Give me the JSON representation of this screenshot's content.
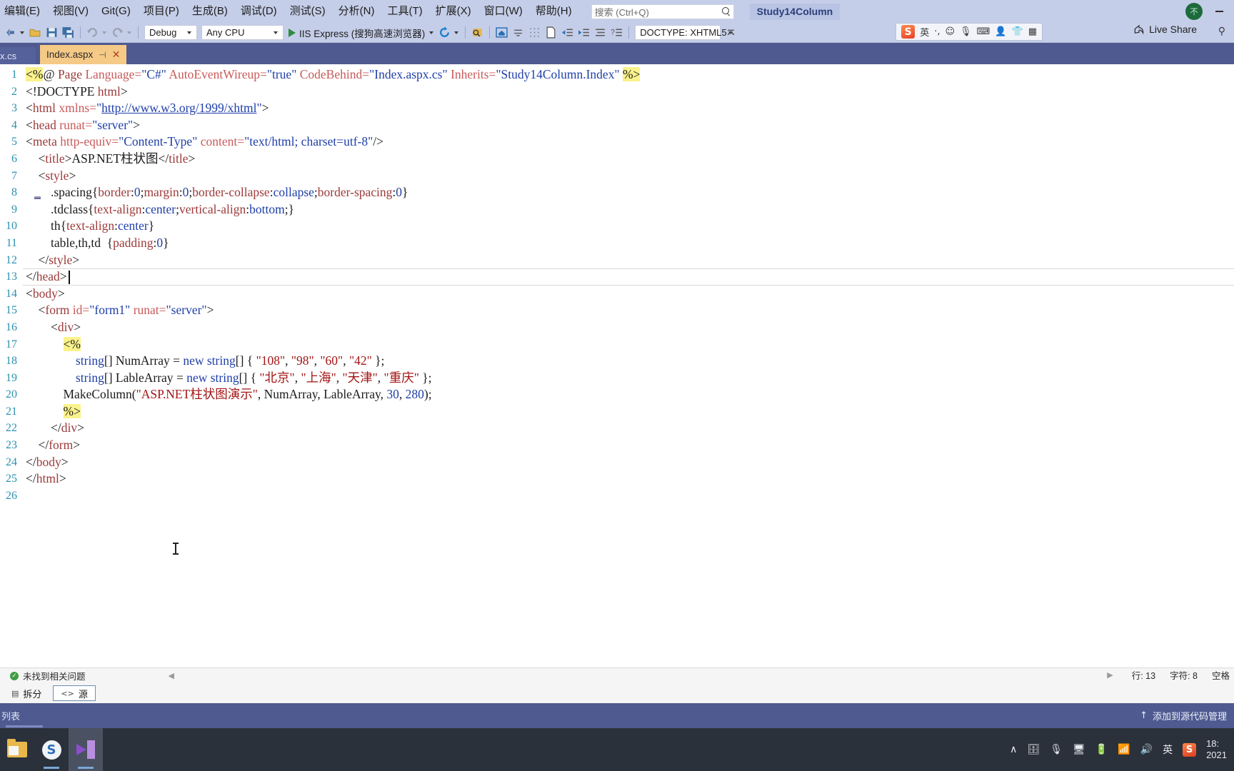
{
  "window": {
    "project_title": "Study14Column",
    "avatar_initials": "不",
    "minimize_label": "—"
  },
  "menubar": {
    "items": [
      {
        "label": "编辑(E)",
        "name": "menu-edit"
      },
      {
        "label": "视图(V)",
        "name": "menu-view"
      },
      {
        "label": "Git(G)",
        "name": "menu-git"
      },
      {
        "label": "项目(P)",
        "name": "menu-project"
      },
      {
        "label": "生成(B)",
        "name": "menu-build"
      },
      {
        "label": "调试(D)",
        "name": "menu-debug"
      },
      {
        "label": "测试(S)",
        "name": "menu-test"
      },
      {
        "label": "分析(N)",
        "name": "menu-analyze"
      },
      {
        "label": "工具(T)",
        "name": "menu-tools"
      },
      {
        "label": "扩展(X)",
        "name": "menu-extensions"
      },
      {
        "label": "窗口(W)",
        "name": "menu-window"
      },
      {
        "label": "帮助(H)",
        "name": "menu-help"
      }
    ],
    "search_placeholder": "搜索 (Ctrl+Q)",
    "search_value": ""
  },
  "toolbar": {
    "config_value": "Debug",
    "platform_value": "Any CPU",
    "run_label": "IIS Express (搜狗高速浏览器)",
    "doctype_value": "DOCTYPE: XHTML5",
    "live_share_label": "Live Share"
  },
  "ime": {
    "brand": "S",
    "mode": "英",
    "icons": [
      "punctuation-icon",
      "emoji-icon",
      "mic-icon",
      "keyboard-icon",
      "user-icon",
      "skin-icon",
      "apps-icon"
    ]
  },
  "tabs": {
    "inactive_label": "x.cs",
    "active_label": "Index.aspx",
    "pin_glyph": "⊣",
    "close_glyph": "✕"
  },
  "editor": {
    "lines": [
      {
        "num": "1",
        "segs": [
          {
            "t": "<%",
            "c": "t-hl"
          },
          {
            "t": "@ ",
            "c": "t-plain"
          },
          {
            "t": "Page ",
            "c": "t-tag"
          },
          {
            "t": "Language=",
            "c": "t-attr"
          },
          {
            "t": "\"C#\"",
            "c": "t-str"
          },
          {
            "t": " ",
            "c": "t-plain"
          },
          {
            "t": "AutoEventWireup=",
            "c": "t-attr"
          },
          {
            "t": "\"true\"",
            "c": "t-str"
          },
          {
            "t": " ",
            "c": "t-plain"
          },
          {
            "t": "CodeBehind=",
            "c": "t-attr"
          },
          {
            "t": "\"Index.aspx.cs\"",
            "c": "t-str"
          },
          {
            "t": " ",
            "c": "t-plain"
          },
          {
            "t": "Inherits=",
            "c": "t-attr"
          },
          {
            "t": "\"Study14Column.Index\"",
            "c": "t-str"
          },
          {
            "t": " ",
            "c": "t-plain"
          },
          {
            "t": "%>",
            "c": "t-hl"
          }
        ]
      },
      {
        "num": "2",
        "segs": [
          {
            "t": "<!DOCTYPE ",
            "c": "t-plain"
          },
          {
            "t": "html",
            "c": "t-tag"
          },
          {
            "t": ">",
            "c": "t-plain"
          }
        ]
      },
      {
        "num": "3",
        "segs": [
          {
            "t": "<",
            "c": "t-plain"
          },
          {
            "t": "html ",
            "c": "t-tag"
          },
          {
            "t": "xmlns=",
            "c": "t-attr"
          },
          {
            "t": "\"",
            "c": "t-str"
          },
          {
            "t": "http://www.w3.org/1999/xhtml",
            "c": "t-link"
          },
          {
            "t": "\"",
            "c": "t-str"
          },
          {
            "t": ">",
            "c": "t-plain"
          }
        ]
      },
      {
        "num": "4",
        "segs": [
          {
            "t": "<",
            "c": "t-plain"
          },
          {
            "t": "head ",
            "c": "t-tag"
          },
          {
            "t": "runat=",
            "c": "t-attr"
          },
          {
            "t": "\"server\"",
            "c": "t-str"
          },
          {
            "t": ">",
            "c": "t-plain"
          }
        ]
      },
      {
        "num": "5",
        "segs": [
          {
            "t": "<",
            "c": "t-plain"
          },
          {
            "t": "meta ",
            "c": "t-tag"
          },
          {
            "t": "http-equiv=",
            "c": "t-attr"
          },
          {
            "t": "\"Content-Type\"",
            "c": "t-str"
          },
          {
            "t": " ",
            "c": "t-plain"
          },
          {
            "t": "content=",
            "c": "t-attr"
          },
          {
            "t": "\"text/html; charset=utf-8\"",
            "c": "t-str"
          },
          {
            "t": "/>",
            "c": "t-plain"
          }
        ]
      },
      {
        "num": "6",
        "segs": [
          {
            "t": "    <",
            "c": "t-plain"
          },
          {
            "t": "title",
            "c": "t-tag"
          },
          {
            "t": ">",
            "c": "t-plain"
          },
          {
            "t": "ASP.NET柱状图",
            "c": "t-plain"
          },
          {
            "t": "</",
            "c": "t-plain"
          },
          {
            "t": "title",
            "c": "t-tag"
          },
          {
            "t": ">",
            "c": "t-plain"
          }
        ]
      },
      {
        "num": "7",
        "segs": [
          {
            "t": "    <",
            "c": "t-plain"
          },
          {
            "t": "style",
            "c": "t-tag"
          },
          {
            "t": ">",
            "c": "t-plain"
          }
        ]
      },
      {
        "num": "8",
        "segs": [
          {
            "t": "        .spacing",
            "c": "t-plain"
          },
          {
            "t": "{",
            "c": "t-plain"
          },
          {
            "t": "border",
            "c": "t-cssprop"
          },
          {
            "t": ":",
            "c": "t-plain"
          },
          {
            "t": "0",
            "c": "t-cssval"
          },
          {
            "t": ";",
            "c": "t-plain"
          },
          {
            "t": "margin",
            "c": "t-cssprop"
          },
          {
            "t": ":",
            "c": "t-plain"
          },
          {
            "t": "0",
            "c": "t-cssval"
          },
          {
            "t": ";",
            "c": "t-plain"
          },
          {
            "t": "border-collapse",
            "c": "t-cssprop"
          },
          {
            "t": ":",
            "c": "t-plain"
          },
          {
            "t": "collapse",
            "c": "t-cssval"
          },
          {
            "t": ";",
            "c": "t-plain"
          },
          {
            "t": "border-spacing",
            "c": "t-cssprop"
          },
          {
            "t": ":",
            "c": "t-plain"
          },
          {
            "t": "0",
            "c": "t-cssval"
          },
          {
            "t": "}",
            "c": "t-plain"
          }
        ]
      },
      {
        "num": "9",
        "segs": [
          {
            "t": "        .tdclass",
            "c": "t-plain"
          },
          {
            "t": "{",
            "c": "t-plain"
          },
          {
            "t": "text-align",
            "c": "t-cssprop"
          },
          {
            "t": ":",
            "c": "t-plain"
          },
          {
            "t": "center",
            "c": "t-cssval"
          },
          {
            "t": ";",
            "c": "t-plain"
          },
          {
            "t": "vertical-align",
            "c": "t-cssprop"
          },
          {
            "t": ":",
            "c": "t-plain"
          },
          {
            "t": "bottom",
            "c": "t-cssval"
          },
          {
            "t": ";}",
            "c": "t-plain"
          }
        ]
      },
      {
        "num": "10",
        "segs": [
          {
            "t": "        th",
            "c": "t-plain"
          },
          {
            "t": "{",
            "c": "t-plain"
          },
          {
            "t": "text-align",
            "c": "t-cssprop"
          },
          {
            "t": ":",
            "c": "t-plain"
          },
          {
            "t": "center",
            "c": "t-cssval"
          },
          {
            "t": "}",
            "c": "t-plain"
          }
        ]
      },
      {
        "num": "11",
        "segs": [
          {
            "t": "        table,th,td  ",
            "c": "t-plain"
          },
          {
            "t": "{",
            "c": "t-plain"
          },
          {
            "t": "padding",
            "c": "t-cssprop"
          },
          {
            "t": ":",
            "c": "t-plain"
          },
          {
            "t": "0",
            "c": "t-cssval"
          },
          {
            "t": "}",
            "c": "t-plain"
          }
        ]
      },
      {
        "num": "12",
        "segs": [
          {
            "t": "    </",
            "c": "t-plain"
          },
          {
            "t": "style",
            "c": "t-tag"
          },
          {
            "t": ">",
            "c": "t-plain"
          }
        ]
      },
      {
        "num": "13",
        "segs": [
          {
            "t": "</",
            "c": "t-plain"
          },
          {
            "t": "head",
            "c": "t-tag"
          },
          {
            "t": ">",
            "c": "t-plain"
          }
        ]
      },
      {
        "num": "14",
        "segs": [
          {
            "t": "<",
            "c": "t-plain"
          },
          {
            "t": "body",
            "c": "t-tag"
          },
          {
            "t": ">",
            "c": "t-plain"
          }
        ]
      },
      {
        "num": "15",
        "segs": [
          {
            "t": "    <",
            "c": "t-plain"
          },
          {
            "t": "form ",
            "c": "t-tag"
          },
          {
            "t": "id=",
            "c": "t-attr"
          },
          {
            "t": "\"form1\"",
            "c": "t-str"
          },
          {
            "t": " ",
            "c": "t-plain"
          },
          {
            "t": "runat=",
            "c": "t-attr"
          },
          {
            "t": "\"server\"",
            "c": "t-str"
          },
          {
            "t": ">",
            "c": "t-plain"
          }
        ]
      },
      {
        "num": "16",
        "segs": [
          {
            "t": "        <",
            "c": "t-plain"
          },
          {
            "t": "div",
            "c": "t-tag"
          },
          {
            "t": ">",
            "c": "t-plain"
          }
        ]
      },
      {
        "num": "17",
        "segs": [
          {
            "t": "            ",
            "c": "t-plain"
          },
          {
            "t": "<%",
            "c": "t-hl"
          }
        ]
      },
      {
        "num": "18",
        "segs": [
          {
            "t": "                ",
            "c": "t-plain"
          },
          {
            "t": "string",
            "c": "t-type"
          },
          {
            "t": "[] ",
            "c": "t-plain"
          },
          {
            "t": "NumArray ",
            "c": "t-id"
          },
          {
            "t": "= ",
            "c": "t-plain"
          },
          {
            "t": "new ",
            "c": "t-type"
          },
          {
            "t": "string",
            "c": "t-type"
          },
          {
            "t": "[] { ",
            "c": "t-plain"
          },
          {
            "t": "\"108\"",
            "c": "t-cstr"
          },
          {
            "t": ", ",
            "c": "t-plain"
          },
          {
            "t": "\"98\"",
            "c": "t-cstr"
          },
          {
            "t": ", ",
            "c": "t-plain"
          },
          {
            "t": "\"60\"",
            "c": "t-cstr"
          },
          {
            "t": ", ",
            "c": "t-plain"
          },
          {
            "t": "\"42\"",
            "c": "t-cstr"
          },
          {
            "t": " };",
            "c": "t-plain"
          }
        ]
      },
      {
        "num": "19",
        "segs": [
          {
            "t": "                ",
            "c": "t-plain"
          },
          {
            "t": "string",
            "c": "t-type"
          },
          {
            "t": "[] ",
            "c": "t-plain"
          },
          {
            "t": "LableArray ",
            "c": "t-id"
          },
          {
            "t": "= ",
            "c": "t-plain"
          },
          {
            "t": "new ",
            "c": "t-type"
          },
          {
            "t": "string",
            "c": "t-type"
          },
          {
            "t": "[] { ",
            "c": "t-plain"
          },
          {
            "t": "\"北京\"",
            "c": "t-cstr"
          },
          {
            "t": ", ",
            "c": "t-plain"
          },
          {
            "t": "\"上海\"",
            "c": "t-cstr"
          },
          {
            "t": ", ",
            "c": "t-plain"
          },
          {
            "t": "\"天津\"",
            "c": "t-cstr"
          },
          {
            "t": ", ",
            "c": "t-plain"
          },
          {
            "t": "\"重庆\"",
            "c": "t-cstr"
          },
          {
            "t": " };",
            "c": "t-plain"
          }
        ]
      },
      {
        "num": "20",
        "segs": [
          {
            "t": "            ",
            "c": "t-plain"
          },
          {
            "t": "MakeColumn",
            "c": "t-id"
          },
          {
            "t": "(",
            "c": "t-plain"
          },
          {
            "t": "\"ASP.NET柱状图演示\"",
            "c": "t-cstr"
          },
          {
            "t": ", ",
            "c": "t-plain"
          },
          {
            "t": "NumArray",
            "c": "t-id"
          },
          {
            "t": ", ",
            "c": "t-plain"
          },
          {
            "t": "LableArray",
            "c": "t-id"
          },
          {
            "t": ", ",
            "c": "t-plain"
          },
          {
            "t": "30",
            "c": "t-num"
          },
          {
            "t": ", ",
            "c": "t-plain"
          },
          {
            "t": "280",
            "c": "t-num"
          },
          {
            "t": ");",
            "c": "t-plain"
          }
        ]
      },
      {
        "num": "21",
        "segs": [
          {
            "t": "            ",
            "c": "t-plain"
          },
          {
            "t": "%>",
            "c": "t-hl"
          }
        ]
      },
      {
        "num": "22",
        "segs": [
          {
            "t": "        </",
            "c": "t-plain"
          },
          {
            "t": "div",
            "c": "t-tag"
          },
          {
            "t": ">",
            "c": "t-plain"
          }
        ]
      },
      {
        "num": "23",
        "segs": [
          {
            "t": "    </",
            "c": "t-plain"
          },
          {
            "t": "form",
            "c": "t-tag"
          },
          {
            "t": ">",
            "c": "t-plain"
          }
        ]
      },
      {
        "num": "24",
        "segs": [
          {
            "t": "</",
            "c": "t-plain"
          },
          {
            "t": "body",
            "c": "t-tag"
          },
          {
            "t": ">",
            "c": "t-plain"
          }
        ]
      },
      {
        "num": "25",
        "segs": [
          {
            "t": "</",
            "c": "t-plain"
          },
          {
            "t": "html",
            "c": "t-tag"
          },
          {
            "t": ">",
            "c": "t-plain"
          }
        ]
      },
      {
        "num": "26",
        "segs": []
      }
    ]
  },
  "errorbar": {
    "status_label": "未找到相关问题"
  },
  "statusbar": {
    "line_label": "行: 13",
    "char_label": "字符: 8",
    "insert_label": "空格"
  },
  "viewtabs": {
    "split_label": "拆分",
    "source_label": "源"
  },
  "dockbar": {
    "left_label": "列表",
    "right_label": "添加到源代码管理",
    "up_glyph": "↑"
  },
  "taskbar": {
    "apps": [
      {
        "name": "taskbar-file-explorer",
        "label": "文件资源管理器"
      },
      {
        "name": "taskbar-sogou-browser",
        "label": "搜狗高速浏览器"
      },
      {
        "name": "taskbar-visual-studio",
        "label": "Visual Studio"
      }
    ],
    "tray": {
      "chevron": "∧",
      "ime_mode": "英",
      "time": "18:",
      "date": "2021"
    }
  }
}
